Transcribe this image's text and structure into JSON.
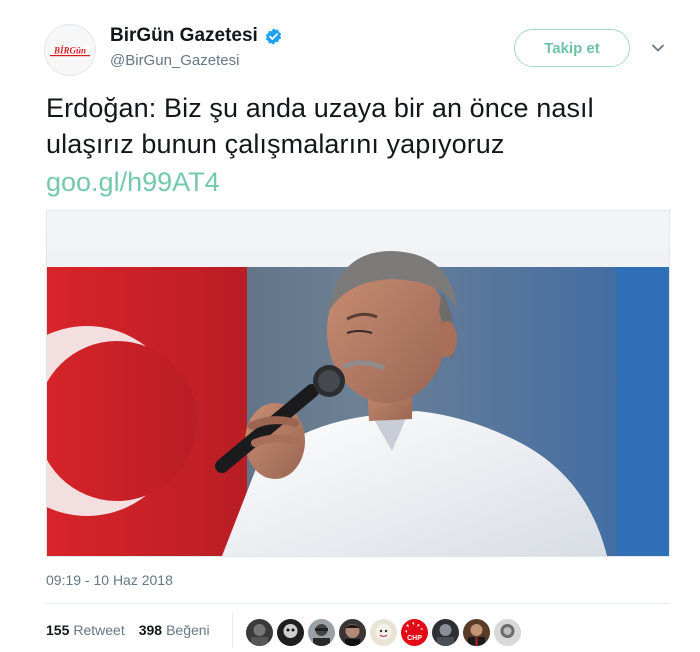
{
  "account": {
    "display_name": "BirGün Gazetesi",
    "handle": "@BirGun_Gazetesi",
    "avatar_logo_text": "BİRGün",
    "verified": true,
    "follow_label": "Takip et"
  },
  "tweet": {
    "text": "Erdoğan: Biz şu anda uzaya bir an önce nasıl ulaşırız bunun çalışmalarını yapıyoruz",
    "link": "goo.gl/h99AT4",
    "timestamp": "09:19 - 10 Haz 2018"
  },
  "stats": {
    "retweets": {
      "count": "155",
      "label": "Retweet"
    },
    "likes": {
      "count": "398",
      "label": "Beğeni"
    }
  },
  "likers": [
    {
      "name": "liker-avatar-1"
    },
    {
      "name": "liker-avatar-2"
    },
    {
      "name": "liker-avatar-3"
    },
    {
      "name": "liker-avatar-4"
    },
    {
      "name": "liker-avatar-5"
    },
    {
      "name": "liker-avatar-chp",
      "text": "CHP"
    },
    {
      "name": "liker-avatar-7"
    },
    {
      "name": "liker-avatar-8"
    },
    {
      "name": "liker-avatar-9"
    }
  ],
  "icons": {
    "verified": "verified-badge-icon",
    "caret": "chevron-down-icon"
  },
  "colors": {
    "link": "#73c9ac",
    "follow": "#6ec3a5",
    "verified": "#1da1f2",
    "muted": "#657786"
  }
}
